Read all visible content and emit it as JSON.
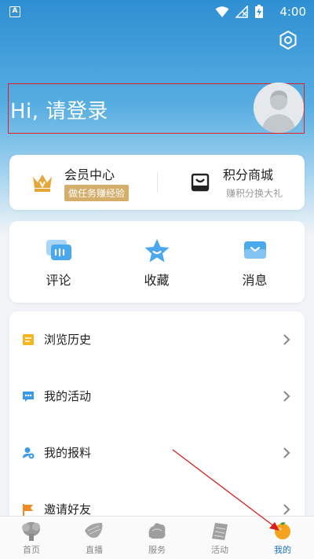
{
  "status_bar": {
    "app_badge": "A",
    "time": "4:00"
  },
  "header": {
    "login_prompt": "Hi, 请登录"
  },
  "member_card": {
    "member_center": {
      "title": "会员中心",
      "subtitle": "做任务赚经验"
    },
    "points_mall": {
      "title": "积分商城",
      "subtitle": "赚积分换大礼"
    }
  },
  "quick_actions": [
    {
      "label": "评论",
      "icon": "comment-icon"
    },
    {
      "label": "收藏",
      "icon": "star-icon"
    },
    {
      "label": "消息",
      "icon": "message-icon"
    }
  ],
  "menu": [
    {
      "label": "浏览历史",
      "icon": "history-icon"
    },
    {
      "label": "我的活动",
      "icon": "activity-icon"
    },
    {
      "label": "我的报料",
      "icon": "report-icon"
    },
    {
      "label": "邀请好友",
      "icon": "invite-flag-icon"
    }
  ],
  "tabbar": [
    {
      "label": "首页"
    },
    {
      "label": "直播"
    },
    {
      "label": "服务"
    },
    {
      "label": "活动"
    },
    {
      "label": "我的",
      "active": true
    }
  ],
  "colors": {
    "accent": "#1a73c9",
    "gold": "#d4ae6a",
    "highlight_border": "#e02020"
  }
}
